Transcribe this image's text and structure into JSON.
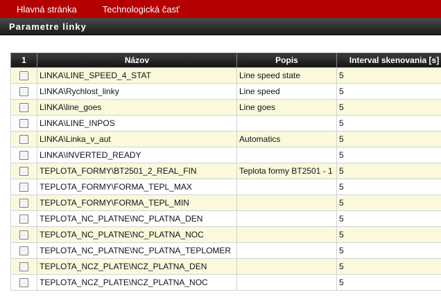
{
  "nav": {
    "home": "Hlavná stránka",
    "tech": "Technologická časť"
  },
  "page_title": "Parametre linky",
  "table": {
    "headers": [
      "1",
      "Názov",
      "Popis",
      "Interval skenovania [s]"
    ],
    "rows": [
      {
        "name": "LINKA\\LINE_SPEED_4_STAT",
        "desc": "Line speed state",
        "interval": "5"
      },
      {
        "name": "LINKA\\Rychlost_linky",
        "desc": "Line speed",
        "interval": "5"
      },
      {
        "name": "LINKA\\line_goes",
        "desc": "Line goes",
        "interval": "5"
      },
      {
        "name": "LINKA\\LINE_INPOS",
        "desc": "",
        "interval": "5"
      },
      {
        "name": "LINKA\\Linka_v_aut",
        "desc": "Automatics",
        "interval": "5"
      },
      {
        "name": "LINKA\\INVERTED_READY",
        "desc": "",
        "interval": "5"
      },
      {
        "name": "TEPLOTA_FORMY\\BT2501_2_REAL_FIN",
        "desc": "Teplota formy BT2501 - 1",
        "interval": "5"
      },
      {
        "name": "TEPLOTA_FORMY\\FORMA_TEPL_MAX",
        "desc": "",
        "interval": "5"
      },
      {
        "name": "TEPLOTA_FORMY\\FORMA_TEPL_MIN",
        "desc": "",
        "interval": "5"
      },
      {
        "name": "TEPLOTA_NC_PLATNE\\NC_PLATNA_DEN",
        "desc": "",
        "interval": "5"
      },
      {
        "name": "TEPLOTA_NC_PLATNE\\NC_PLATNA_NOC",
        "desc": "",
        "interval": "5"
      },
      {
        "name": "TEPLOTA_NC_PLATNE\\NC_PLATNA_TEPLOMER",
        "desc": "",
        "interval": "5"
      },
      {
        "name": "TEPLOTA_NCZ_PLATE\\NCZ_PLATNA_DEN",
        "desc": "",
        "interval": "5"
      },
      {
        "name": "TEPLOTA_NCZ_PLATE\\NCZ_PLATNA_NOC",
        "desc": "",
        "interval": "5"
      }
    ]
  }
}
